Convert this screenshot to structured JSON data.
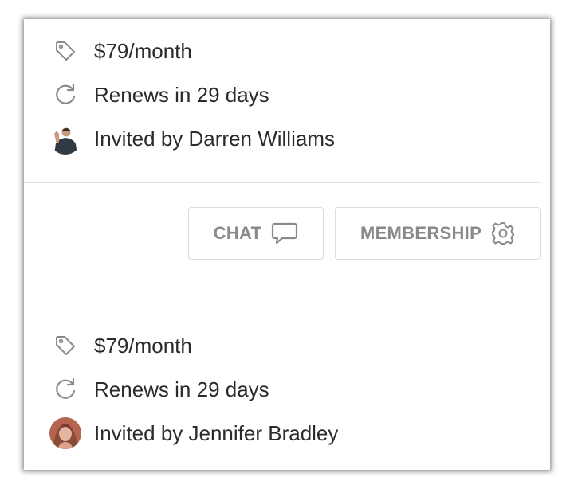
{
  "memberships": [
    {
      "price": "$79/month",
      "renewal": "Renews in 29 days",
      "invited_by": "Invited by Darren Williams"
    },
    {
      "price": "$79/month",
      "renewal": "Renews in 29 days",
      "invited_by": "Invited by Jennifer Bradley"
    }
  ],
  "actions": {
    "chat_label": "CHAT",
    "membership_label": "MEMBERSHIP"
  },
  "icons": {
    "price": "tag-icon",
    "renewal": "refresh-icon",
    "chat": "chat-bubble-icon",
    "membership": "gear-icon"
  },
  "colors": {
    "text": "#2b2b2b",
    "icon": "#8a8a8a",
    "button_text": "#8a8a8a",
    "button_border": "#dcdcdc"
  }
}
